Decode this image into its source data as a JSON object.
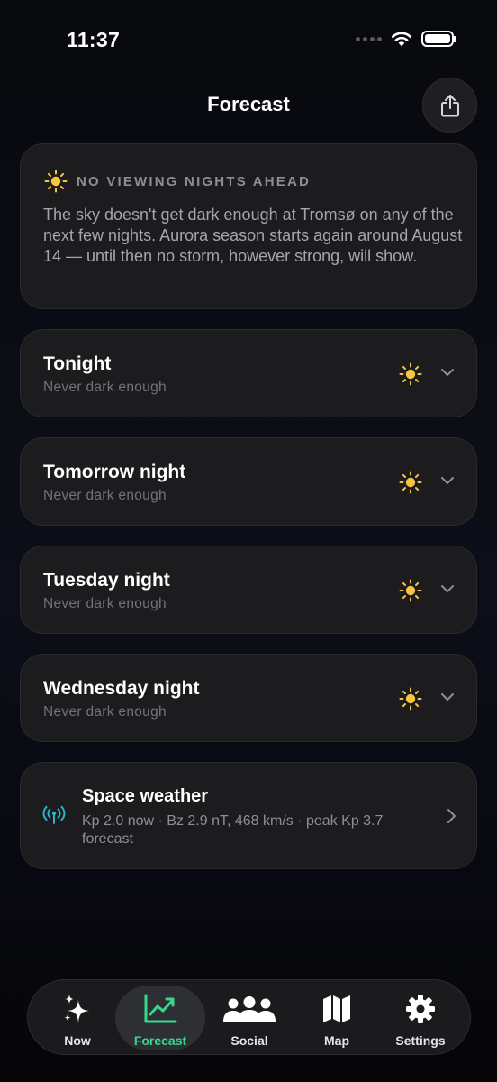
{
  "status_bar": {
    "time": "11:37"
  },
  "header": {
    "title": "Forecast",
    "share_icon": "share-icon"
  },
  "alert": {
    "icon": "sun-icon",
    "label": "NO VIEWING NIGHTS AHEAD",
    "body": "The sky doesn't get dark enough at Tromsø on any of the next few nights. Aurora season starts again around August 14 — until then no storm, however strong, will show."
  },
  "nights": [
    {
      "title": "Tonight",
      "subtitle": "Never dark enough"
    },
    {
      "title": "Tomorrow night",
      "subtitle": "Never dark enough"
    },
    {
      "title": "Tuesday night",
      "subtitle": "Never dark enough"
    },
    {
      "title": "Wednesday night",
      "subtitle": "Never dark enough"
    }
  ],
  "space_weather": {
    "title": "Space weather",
    "detail": "Kp 2.0 now · Bz 2.9 nT, 468 km/s · peak Kp 3.7 forecast",
    "icon": "antenna-icon"
  },
  "tabs": [
    {
      "label": "Now",
      "icon": "sparkles-icon",
      "active": false
    },
    {
      "label": "Forecast",
      "icon": "chart-icon",
      "active": true
    },
    {
      "label": "Social",
      "icon": "people-icon",
      "active": false
    },
    {
      "label": "Map",
      "icon": "map-icon",
      "active": false
    },
    {
      "label": "Settings",
      "icon": "gear-icon",
      "active": false
    }
  ],
  "colors": {
    "accent_green": "#37d88d",
    "sun_yellow": "#f5c542",
    "antenna_teal": "#2ab3c9",
    "card_bg": "#1c1c1f"
  }
}
